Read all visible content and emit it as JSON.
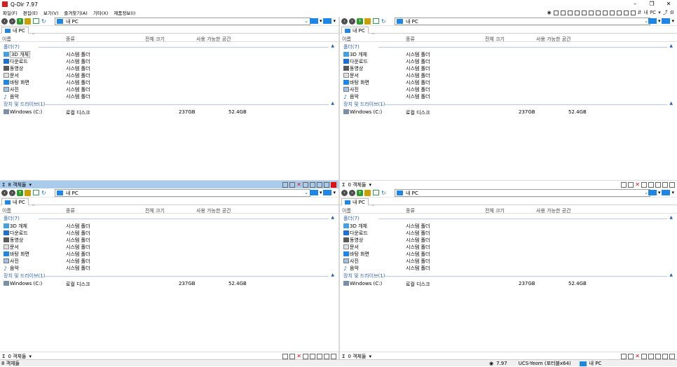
{
  "app": {
    "title": "Q-Dir 7.97",
    "window_controls": [
      "–",
      "❐",
      "✕"
    ]
  },
  "menu": [
    "파일(F)",
    "편집(E)",
    "보기(V)",
    "즐겨찾기(A)",
    "기타(X)",
    "제품정보(I)"
  ],
  "menu_tools": {
    "pc_label": "내 PC"
  },
  "panes": [
    {
      "address": "내 PC",
      "tab": "내 PC",
      "status": "8 객체들",
      "active": true
    },
    {
      "address": "내 PC",
      "tab": "내 PC",
      "status": "0 객체들",
      "active": false
    },
    {
      "address": "내 PC",
      "tab": "내 PC",
      "status": "0 객체들",
      "active": false
    },
    {
      "address": "내 PC",
      "tab": "내 PC",
      "status": "0 객체들",
      "active": false
    }
  ],
  "columns": {
    "name": "이름",
    "type": "종류",
    "total": "전체 크기",
    "free": "사용 가능한 공간"
  },
  "groups": {
    "folders": "폴더(7)",
    "devices": "장치 및 드라이브(1)"
  },
  "folders": [
    {
      "name": "3D 개체",
      "type": "시스템 폴더",
      "icon": "3d-objects-icon"
    },
    {
      "name": "다운로드",
      "type": "시스템 폴더",
      "icon": "download-icon"
    },
    {
      "name": "동영상",
      "type": "시스템 폴더",
      "icon": "video-icon"
    },
    {
      "name": "문서",
      "type": "시스템 폴더",
      "icon": "document-icon"
    },
    {
      "name": "바탕 화면",
      "type": "시스템 폴더",
      "icon": "desktop-icon"
    },
    {
      "name": "사진",
      "type": "시스템 폴더",
      "icon": "picture-icon"
    },
    {
      "name": "음악",
      "type": "시스템 폴더",
      "icon": "music-icon"
    }
  ],
  "drive": {
    "name": "Windows (C:)",
    "type": "로컬 디스크",
    "total": "237GB",
    "free": "52.4GB"
  },
  "bottom": {
    "left": "8 객체들",
    "version": "7.97",
    "user": "UCS-Yeom (포터블x64)",
    "pc": "내 PC"
  }
}
